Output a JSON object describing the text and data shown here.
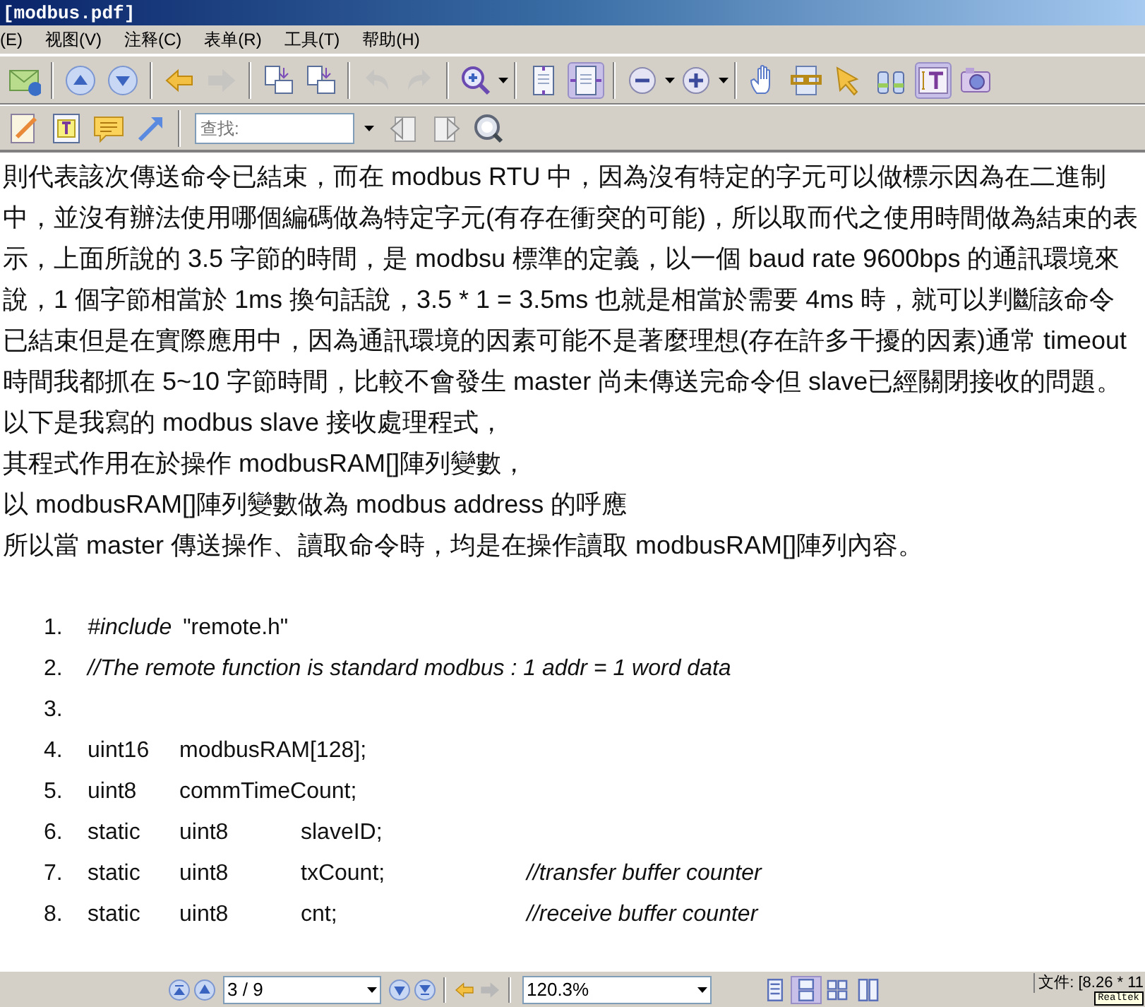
{
  "window": {
    "title": "[modbus.pdf]"
  },
  "menu": [
    {
      "label": "(E)"
    },
    {
      "label": "视图(V)"
    },
    {
      "label": "注释(C)"
    },
    {
      "label": "表单(R)"
    },
    {
      "label": "工具(T)"
    },
    {
      "label": "帮助(H)"
    }
  ],
  "main_toolbar": [
    {
      "selected": false,
      "disabled": false
    },
    {
      "selected": false,
      "disabled": false
    },
    {
      "selected": false,
      "disabled": false
    },
    {
      "selected": false,
      "disabled": false
    },
    {
      "selected": false,
      "disabled": true
    },
    {
      "selected": false,
      "disabled": false
    },
    {
      "selected": false,
      "disabled": false
    },
    {
      "selected": false,
      "disabled": true
    },
    {
      "selected": false,
      "disabled": true
    },
    {
      "selected": false,
      "disabled": false
    },
    {
      "selected": false,
      "disabled": false
    },
    {
      "selected": true,
      "disabled": false
    },
    {
      "selected": false,
      "disabled": false
    },
    {
      "selected": false,
      "disabled": false
    },
    {
      "selected": false,
      "disabled": false
    },
    {
      "selected": false,
      "disabled": false
    },
    {
      "selected": false,
      "disabled": false
    },
    {
      "selected": false,
      "disabled": false
    },
    {
      "selected": true,
      "disabled": false
    },
    {
      "selected": false,
      "disabled": false
    }
  ],
  "search": {
    "placeholder": "查找:"
  },
  "document": {
    "paragraph": "則代表該次傳送命令已結束，而在 modbus RTU 中，因為沒有特定的字元可以做標示因為在二進制中，並沒有辦法使用哪個編碼做為特定字元(有存在衝突的可能)，所以取而代之使用時間做為結束的表示，上面所說的 3.5 字節的時間，是 modbsu 標準的定義，以一個 baud rate 9600bps 的通訊環境來說，1 個字節相當於 1ms 換句話說，3.5 * 1 = 3.5ms 也就是相當於需要 4ms 時，就可以判斷該命令已結束但是在實際應用中，因為通訊環境的因素可能不是著麼理想(存在許多干擾的因素)通常 timeout 時間我都抓在 5~10 字節時間，比較不會發生 master 尚未傳送完命令但 slave已經關閉接收的問題。",
    "lines": [
      "以下是我寫的 modbus slave 接收處理程式，",
      "其程式作用在於操作 modbusRAM[]陣列變數，",
      "以 modbusRAM[]陣列變數做為 modbus address 的呼應",
      "所以當 master 傳送操作、讀取命令時，均是在操作讀取 modbusRAM[]陣列內容。"
    ],
    "code": [
      {
        "number": "1.",
        "cells": [
          {
            "text": "#include",
            "italic": true
          },
          {
            "text": "\"remote.h\"",
            "italic": false
          }
        ]
      },
      {
        "number": "2.",
        "cells": [
          {
            "text": "//The remote function is standard modbus : 1 addr = 1 word data",
            "italic": true
          }
        ]
      },
      {
        "number": "3."
      },
      {
        "number": "4.",
        "cells": [
          {
            "text": "uint16",
            "italic": false
          },
          {
            "text": "modbusRAM[128];",
            "italic": false
          }
        ]
      },
      {
        "number": "5.",
        "cells": [
          {
            "text": "uint8",
            "italic": false
          },
          {
            "text": "commTimeCount;",
            "italic": false
          }
        ]
      },
      {
        "number": "6.",
        "cells": [
          {
            "text": "static",
            "italic": false
          },
          {
            "text": "uint8",
            "italic": false
          },
          {
            "text": "slaveID;",
            "italic": false
          }
        ]
      },
      {
        "number": "7.",
        "cells": [
          {
            "text": "static",
            "italic": false
          },
          {
            "text": "uint8",
            "italic": false
          },
          {
            "text": "txCount;",
            "italic": false
          },
          {
            "text": "//transfer buffer counter",
            "italic": true
          }
        ]
      },
      {
        "number": "8.",
        "cells": [
          {
            "text": "static",
            "italic": false
          },
          {
            "text": "uint8",
            "italic": false
          },
          {
            "text": "cnt;",
            "italic": false
          },
          {
            "text": "//receive buffer counter",
            "italic": true
          }
        ]
      }
    ]
  },
  "status_bar": {
    "page": "3 / 9",
    "back_disabled": false,
    "forward_disabled": true,
    "zoom": "120.3%",
    "views": [
      {
        "selected": false
      },
      {
        "selected": true
      },
      {
        "selected": false
      },
      {
        "selected": false
      }
    ],
    "file_info": "文件: [8.26 * 11",
    "tooltip": "Realtek"
  }
}
